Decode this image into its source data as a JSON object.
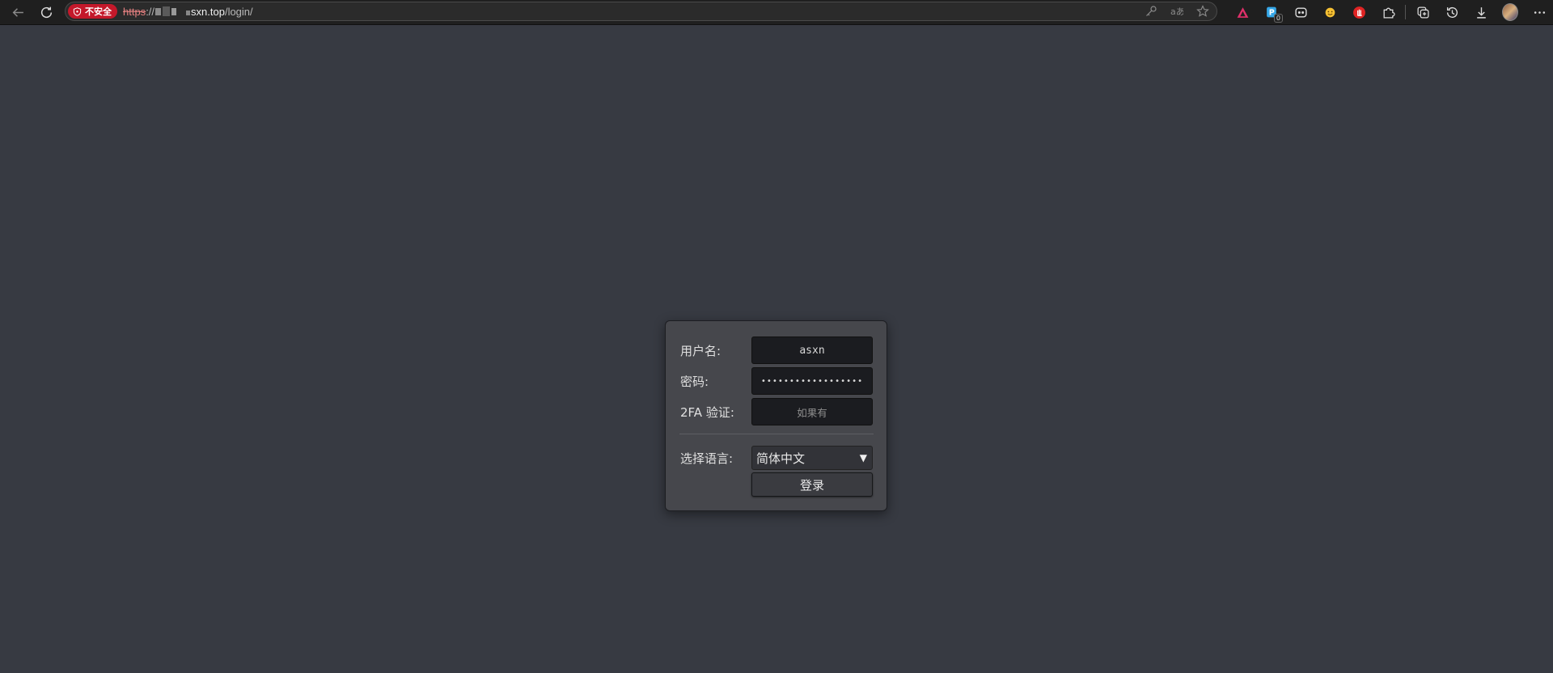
{
  "browser": {
    "security_badge": "不安全",
    "url": {
      "scheme": "https",
      "separator": "://",
      "host": "sxn.top",
      "path": "/login/"
    },
    "extension_badge_count": "0"
  },
  "login": {
    "username_label": "用户名:",
    "username_value": "asxn",
    "password_label": "密码:",
    "password_masked": "••••••••••••••••••",
    "twofa_label": "2FA 验证:",
    "twofa_placeholder": "如果有",
    "language_label": "选择语言:",
    "language_selected": "简体中文",
    "submit_label": "登录"
  },
  "colors": {
    "page_background": "#373a42",
    "panel_background": "#46474c",
    "insecure_red": "#c4182a"
  }
}
